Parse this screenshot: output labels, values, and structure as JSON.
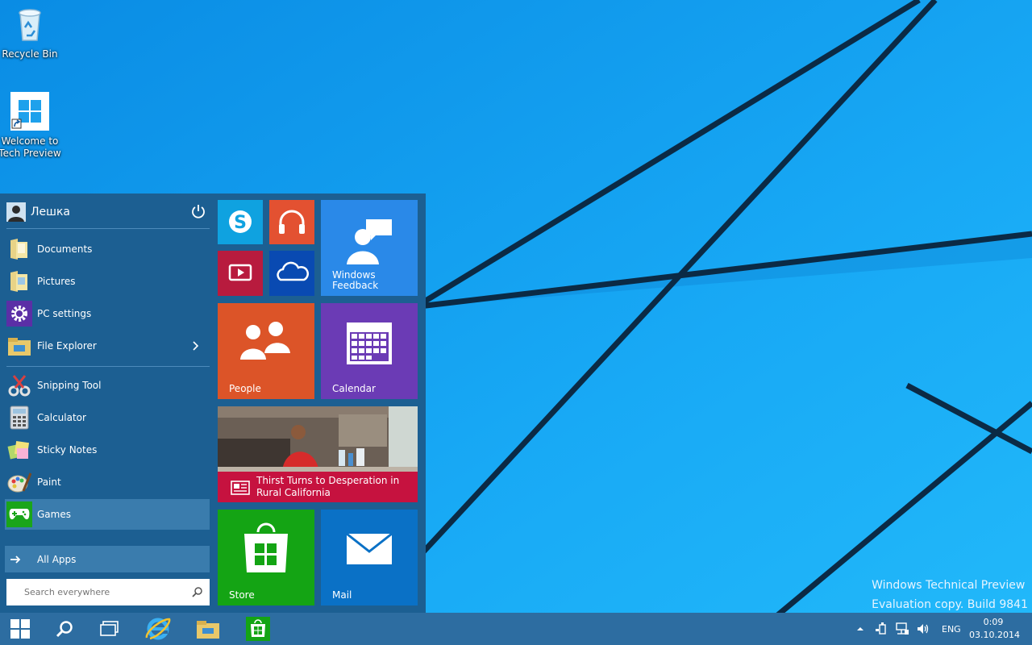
{
  "desktop": {
    "icons": [
      {
        "label": "Recycle Bin"
      },
      {
        "label": "Welcome to Tech Preview"
      }
    ],
    "watermark": {
      "line1": "Windows Technical Preview",
      "line2": "Evaluation copy. Build 9841"
    }
  },
  "start_menu": {
    "user_name": "Лешка",
    "items_top": [
      {
        "label": "Documents",
        "icon": "folder-icon"
      },
      {
        "label": "Pictures",
        "icon": "folder-icon"
      },
      {
        "label": "PC settings",
        "icon": "gear-icon"
      },
      {
        "label": "File Explorer",
        "icon": "file-explorer-icon"
      }
    ],
    "items_apps": [
      {
        "label": "Snipping Tool",
        "icon": "snipping-tool-icon"
      },
      {
        "label": "Calculator",
        "icon": "calculator-icon"
      },
      {
        "label": "Sticky Notes",
        "icon": "sticky-notes-icon"
      },
      {
        "label": "Paint",
        "icon": "paint-icon"
      },
      {
        "label": "Games",
        "icon": "games-icon"
      }
    ],
    "all_apps_label": "All Apps",
    "search_placeholder": "Search everywhere",
    "tiles": {
      "feedback": "Windows Feedback",
      "people": "People",
      "calendar": "Calendar",
      "news_headline": "Thirst Turns to Desperation in Rural California",
      "store": "Store",
      "mail": "Mail"
    },
    "colors": {
      "skype": "#0fa2e0",
      "music": "#e35131",
      "video": "#b81b3e",
      "onedrive": "#094ab2",
      "feedback": "#2a89e8",
      "people": "#dc5428",
      "calendar": "#6b3bb5",
      "news": "#c6123f",
      "store": "#14a414",
      "mail": "#0a71c6"
    }
  },
  "taskbar": {
    "language": "ENG",
    "time": "0:09",
    "date": "03.10.2014"
  }
}
